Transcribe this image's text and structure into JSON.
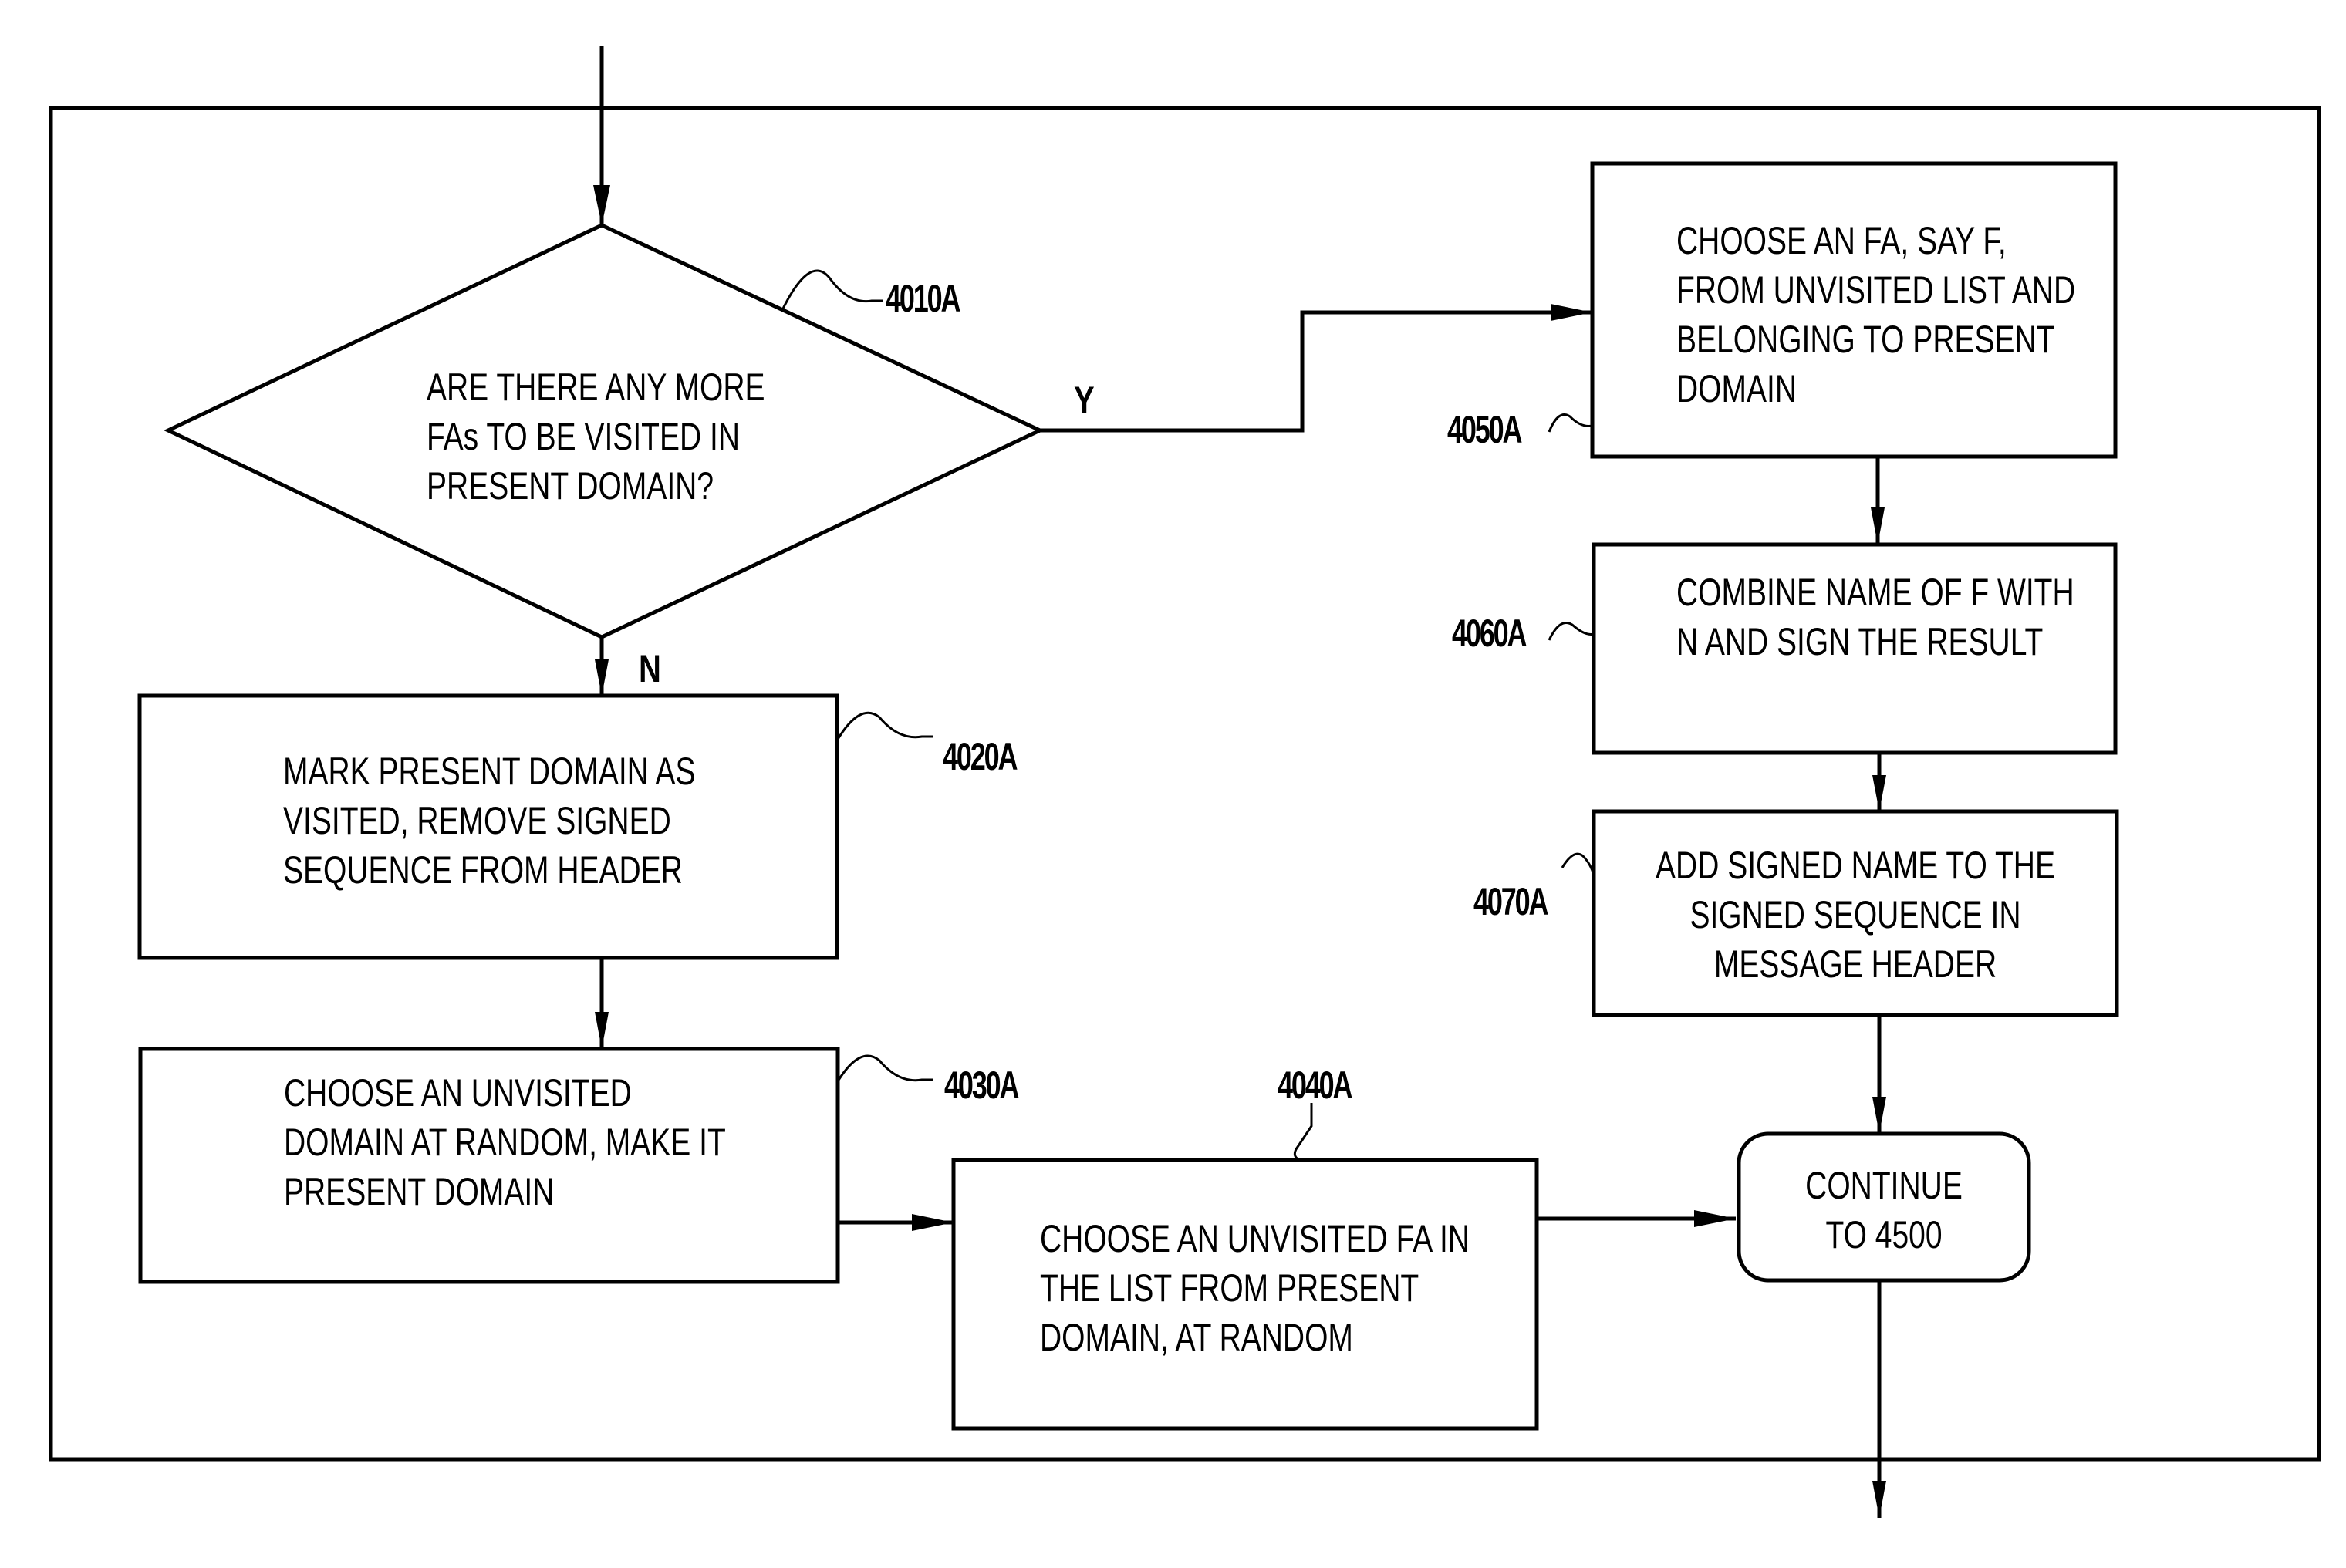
{
  "diagram": {
    "type": "flowchart",
    "nodes": [
      {
        "id": "4010A",
        "shape": "decision",
        "ref": "4010A",
        "lines": [
          "ARE THERE ANY MORE",
          "FAs TO BE VISITED IN",
          "PRESENT DOMAIN?"
        ]
      },
      {
        "id": "4020A",
        "shape": "process",
        "ref": "4020A",
        "lines": [
          "MARK PRESENT DOMAIN AS",
          "VISITED, REMOVE SIGNED",
          "SEQUENCE FROM HEADER"
        ]
      },
      {
        "id": "4030A",
        "shape": "process",
        "ref": "4030A",
        "lines": [
          "CHOOSE AN UNVISITED",
          "DOMAIN AT RANDOM, MAKE IT",
          "PRESENT DOMAIN"
        ]
      },
      {
        "id": "4040A",
        "shape": "process",
        "ref": "4040A",
        "lines": [
          "CHOOSE AN UNVISITED FA IN",
          "THE LIST FROM PRESENT",
          "DOMAIN, AT RANDOM"
        ]
      },
      {
        "id": "4050A",
        "shape": "process",
        "ref": "4050A",
        "lines": [
          "CHOOSE AN FA, SAY F,",
          "FROM UNVISITED LIST AND",
          "BELONGING TO PRESENT",
          "DOMAIN"
        ]
      },
      {
        "id": "4060A",
        "shape": "process",
        "ref": "4060A",
        "lines": [
          "COMBINE NAME OF F WITH",
          "N AND SIGN THE RESULT"
        ]
      },
      {
        "id": "4070A",
        "shape": "process",
        "ref": "4070A",
        "lines": [
          "ADD SIGNED NAME TO THE",
          "SIGNED SEQUENCE IN",
          "MESSAGE HEADER"
        ]
      },
      {
        "id": "continue",
        "shape": "terminal",
        "lines": [
          "CONTINUE",
          "TO 4500"
        ]
      }
    ],
    "edges": [
      {
        "from": "entry",
        "to": "4010A",
        "label": ""
      },
      {
        "from": "4010A",
        "to": "4050A",
        "label": "Y"
      },
      {
        "from": "4010A",
        "to": "4020A",
        "label": "N"
      },
      {
        "from": "4020A",
        "to": "4030A",
        "label": ""
      },
      {
        "from": "4030A",
        "to": "4040A",
        "label": ""
      },
      {
        "from": "4040A",
        "to": "continue",
        "label": ""
      },
      {
        "from": "4050A",
        "to": "4060A",
        "label": ""
      },
      {
        "from": "4060A",
        "to": "4070A",
        "label": ""
      },
      {
        "from": "4070A",
        "to": "continue",
        "label": ""
      },
      {
        "from": "continue",
        "to": "exit",
        "label": ""
      }
    ],
    "texts": {
      "decision": "ARE THERE ANY MORE\nFAs TO BE VISITED IN\nPRESENT DOMAIN?",
      "n4020": "MARK PRESENT DOMAIN AS\nVISITED, REMOVE SIGNED\nSEQUENCE FROM HEADER",
      "n4030": "CHOOSE AN UNVISITED\nDOMAIN AT RANDOM, MAKE IT\nPRESENT DOMAIN",
      "n4040": "CHOOSE AN UNVISITED FA IN\nTHE LIST FROM PRESENT\nDOMAIN, AT RANDOM",
      "n4050": "CHOOSE AN FA, SAY F,\nFROM UNVISITED LIST AND\nBELONGING TO PRESENT\nDOMAIN",
      "n4060": "COMBINE NAME OF F WITH\nN AND SIGN THE RESULT",
      "n4070": "ADD SIGNED NAME TO THE\nSIGNED SEQUENCE IN\nMESSAGE HEADER",
      "continue": "CONTINUE\nTO 4500"
    },
    "refs": {
      "r4010": "4010A",
      "r4020": "4020A",
      "r4030": "4030A",
      "r4040": "4040A",
      "r4050": "4050A",
      "r4060": "4060A",
      "r4070": "4070A"
    },
    "branch_labels": {
      "yes": "Y",
      "no": "N"
    }
  }
}
